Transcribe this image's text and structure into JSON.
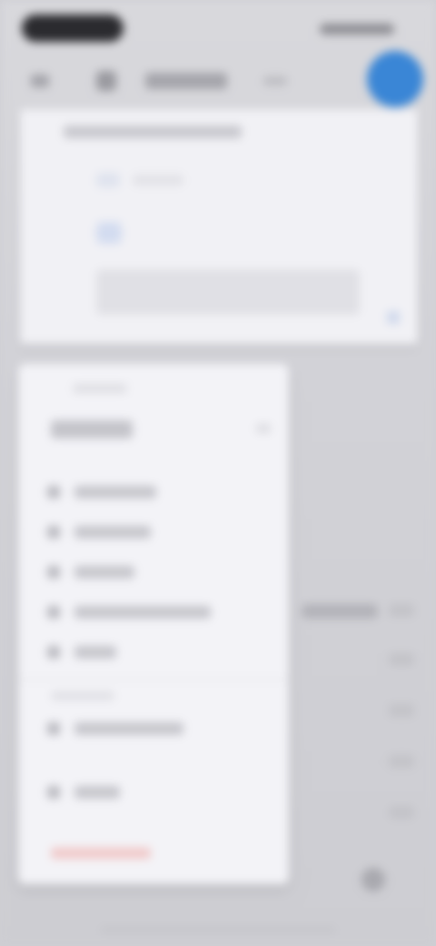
{
  "status_bar": {
    "time": ""
  },
  "nav": {
    "title": ""
  },
  "top_panel": {
    "header": "",
    "row1": "",
    "field_placeholder": ""
  },
  "menu": {
    "caption": "",
    "heading": "",
    "items": [
      {
        "label": ""
      },
      {
        "label": ""
      },
      {
        "label": ""
      },
      {
        "label": ""
      },
      {
        "label": ""
      }
    ],
    "section_label": "",
    "extra_items": [
      {
        "label": ""
      },
      {
        "label": ""
      }
    ],
    "danger_label": ""
  },
  "right_list": {
    "label": ""
  },
  "colors": {
    "accent": "#3a86d6",
    "danger": "#e35c5c"
  },
  "icons": {
    "back": "back-arrow-icon",
    "app": "app-icon",
    "fab": "add-icon"
  }
}
